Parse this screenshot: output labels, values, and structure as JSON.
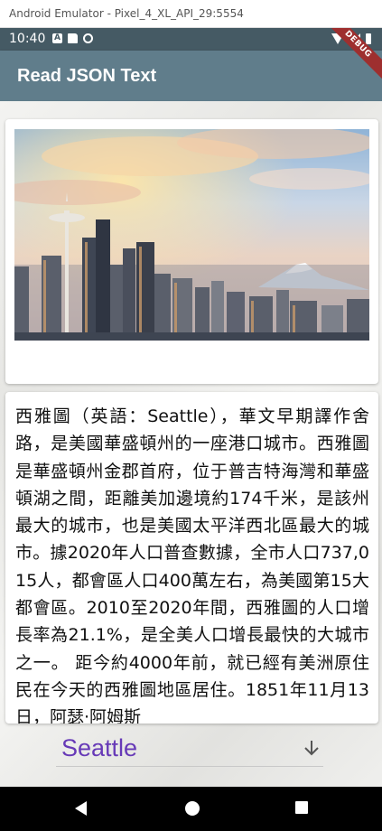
{
  "emulator": {
    "title": "Android Emulator - Pixel_4_XL_API_29:5554"
  },
  "status_bar": {
    "time": "10:40",
    "a_icon_letter": "A"
  },
  "app_bar": {
    "title": "Read JSON Text",
    "color": "#607d8b"
  },
  "debug_banner": {
    "label": "DEBUG"
  },
  "image_card": {
    "image": "seattle-skyline-with-space-needle-and-mount-rainier"
  },
  "text_card": {
    "body": "西雅圖（英語：Seattle），華文早期譯作舍路，是美國華盛頓州的一座港口城市。西雅圖是華盛頓州金郡首府，位于普吉特海灣和華盛頓湖之間，距離美加邊境約174千米，是該州最大的城市，也是美國太平洋西北區最大的城市。據2020年人口普查數據，全市人口737,015人，都會區人口400萬左右，為美國第15大都會區。2010至2020年間，西雅圖的人口增長率為21.1%，是全美人口增長最快的大城市之一。 距今約4000年前，就已經有美洲原住民在今天的西雅圖地區居住。1851年11月13日，阿瑟·阿姆斯"
  },
  "dropdown": {
    "selected": "Seattle",
    "color": "#673ab7"
  },
  "nav_bar": {
    "icons": [
      "back-icon",
      "home-icon",
      "recents-icon"
    ]
  }
}
